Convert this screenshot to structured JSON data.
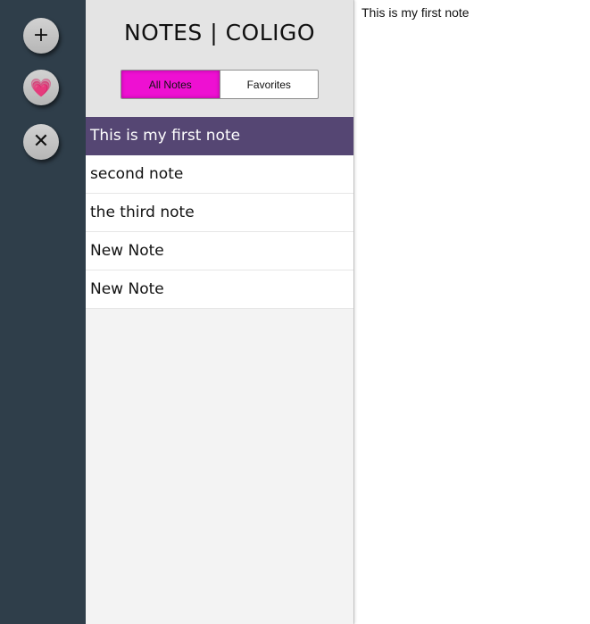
{
  "rail": {
    "add_icon": "plus-icon",
    "add_glyph": "+",
    "favorite_icon": "heart-icon",
    "favorite_glyph": "💗",
    "delete_icon": "close-icon",
    "delete_glyph": "✕"
  },
  "header": {
    "title": "NOTES | COLIGO"
  },
  "filter": {
    "all_label": "All Notes",
    "favorites_label": "Favorites",
    "active": "all"
  },
  "notes": [
    {
      "title": "This is my first note",
      "selected": true
    },
    {
      "title": "second note",
      "selected": false
    },
    {
      "title": "the third note",
      "selected": false
    },
    {
      "title": "New Note",
      "selected": false
    },
    {
      "title": "New Note",
      "selected": false
    }
  ],
  "editor": {
    "content": "This is my first note"
  },
  "colors": {
    "rail_bg": "#2f3e4a",
    "header_bg": "#e4e4e4",
    "list_bg": "#f3f3f3",
    "active_filter": "#ee10d2",
    "selected_note": "#554673"
  }
}
